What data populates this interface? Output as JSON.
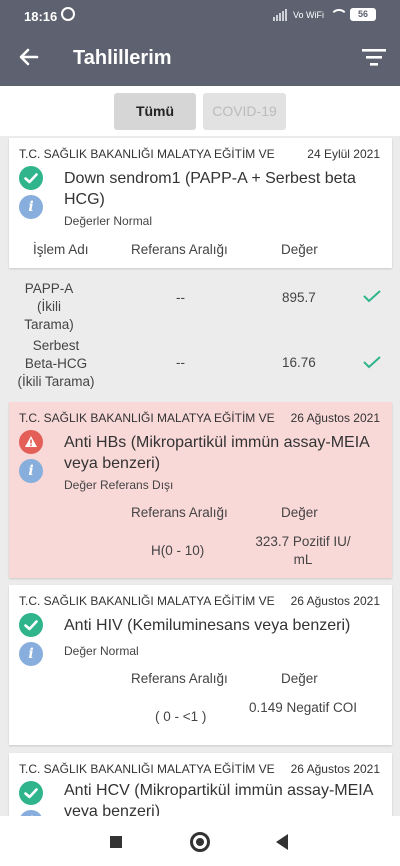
{
  "statusbar": {
    "time": "18:16",
    "network": "Vo WiFi",
    "battery": "56"
  },
  "appbar": {
    "title": "Tahlillerim"
  },
  "tabs": [
    {
      "label": "Tümü",
      "selected": true
    },
    {
      "label": "COVID-19",
      "selected": false
    }
  ],
  "cards": [
    {
      "institution": "T.C. SAĞLIK BAKANLIĞI MALATYA EĞİTİM VE",
      "date": "24 Eylül 2021",
      "status": "ok",
      "test_name": "Down sendrom1 (PAPP-A + Serbest beta HCG)",
      "result_status": "Değerler Normal",
      "headers": {
        "name": "İşlem Adı",
        "range": "Referans Aralığı",
        "value": "Değer"
      },
      "rows": [
        {
          "name": "PAPP-A (İkili Tarama)",
          "range": "--",
          "value": "895.7"
        },
        {
          "name": "Serbest Beta-HCG (İkili Tarama)",
          "range": "--",
          "value": "16.76"
        }
      ]
    },
    {
      "institution": "T.C. SAĞLIK BAKANLIĞI MALATYA EĞİTİM VE",
      "date": "26 Ağustos 2021",
      "status": "warning",
      "test_name": "Anti HBs (Mikropartikül immün assay-MEIA veya benzeri)",
      "result_status": "Değer Referans Dışı",
      "headers": {
        "range": "Referans Aralığı",
        "value": "Değer"
      },
      "rows": [
        {
          "range": "H(0 - 10)",
          "value": "323.7 Pozitif IU/ mL"
        }
      ]
    },
    {
      "institution": "T.C. SAĞLIK BAKANLIĞI MALATYA EĞİTİM VE",
      "date": "26 Ağustos 2021",
      "status": "ok",
      "test_name": "Anti HIV (Kemiluminesans veya benzeri)",
      "result_status": "Değer Normal",
      "headers": {
        "range": "Referans Aralığı",
        "value": "Değer"
      },
      "rows": [
        {
          "range": "( 0 - <1 )",
          "value": "0.149 Negatif COI"
        }
      ]
    },
    {
      "institution": "T.C. SAĞLIK BAKANLIĞI MALATYA EĞİTİM VE",
      "date": "26 Ağustos 2021",
      "status": "ok",
      "test_name": "Anti HCV (Mikropartikül immün assay-MEIA veya benzeri)"
    }
  ],
  "colors": {
    "appbar": "#5e6270",
    "ok": "#2fb48b",
    "warning": "#e35f57",
    "info": "#87aedc",
    "alert_bg": "#f9d9d8"
  }
}
